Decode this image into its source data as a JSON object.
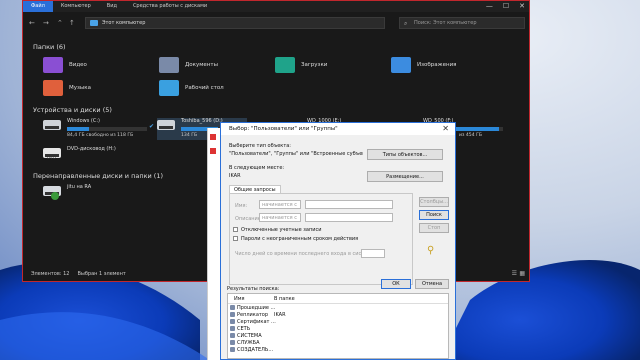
{
  "explorer": {
    "menu": [
      "Файл",
      "Компьютер",
      "Вид",
      "Средства работы с дисками"
    ],
    "active_menu_index": 0,
    "address": "Этот компьютер",
    "search_placeholder": "Поиск: Этот компьютер",
    "nav": {
      "back": "←",
      "forward": "→",
      "up": "⌃",
      "up2": "↑"
    },
    "folders_header": "Папки (6)",
    "folders": [
      {
        "label": "Видео",
        "icon": "video-folder-icon",
        "color": "#8a4fd3"
      },
      {
        "label": "Документы",
        "icon": "documents-folder-icon",
        "color": "#7a8aa8"
      },
      {
        "label": "Загрузки",
        "icon": "downloads-folder-icon",
        "color": "#1fa38a"
      },
      {
        "label": "Изображения",
        "icon": "pictures-folder-icon",
        "color": "#3c8ce0"
      },
      {
        "label": "Музыка",
        "icon": "music-folder-icon",
        "color": "#e0603c"
      },
      {
        "label": "Рабочий стол",
        "icon": "desktop-folder-icon",
        "color": "#3aa0e0"
      }
    ],
    "drives_header": "Устройства и диски (5)",
    "drives": [
      {
        "name": "Windows (C:)",
        "free": "84,4 ГБ свободно из 118 ГБ",
        "used": 0.28
      },
      {
        "name": "Toshiba_596 (D:)",
        "free": "134 ГБ",
        "used": 0.6
      },
      {
        "name": "WD_1000 (E:)",
        "free": "",
        "used": 0.9
      },
      {
        "name": "WD_500 (F:)",
        "free": "из 454 ГБ",
        "used": 0.95
      }
    ],
    "dvd": {
      "name": "DVD-дисковод (H:)",
      "sub": "DVD"
    },
    "network_header": "Перенаправленные диски и папки (1)",
    "network": [
      {
        "name": "jitu на RA"
      }
    ],
    "status": {
      "items": "Элементов: 12",
      "selected": "Выбран 1 элемент"
    },
    "window_controls": {
      "min": "—",
      "max": "☐",
      "close": "✕"
    }
  },
  "dialog": {
    "title": "Выбор: \"Пользователи\" или \"Группы\"",
    "close": "✕",
    "object_type_label": "Выберите тип объекта:",
    "object_type_value": "\"Пользователи\", \"Группы\" или \"Встроенные субъекты безопасности\"",
    "object_types_button": "Типы объектов...",
    "location_label": "В следующем месте:",
    "location_value": "IKAR",
    "location_button": "Размещение...",
    "tab_label": "Общие запросы",
    "name_label": "Имя:",
    "name_op": "начинается с",
    "desc_label": "Описание:",
    "desc_op": "начинается с",
    "check_disabled": "Отключенные учетные записи",
    "check_noexpire": "Пароли с неограниченным сроком действия",
    "days_label": "Число дней со времени последнего входа в систему:",
    "columns_button": "Столбцы...",
    "find_button": "Поиск",
    "stop_button": "Стоп",
    "ok_button": "ОК",
    "cancel_button": "Отмена",
    "results_label": "Результаты поиска:",
    "results_columns": [
      "Имя",
      "В папке"
    ],
    "results": [
      {
        "name": "Прошедшие ...",
        "folder": ""
      },
      {
        "name": "Репликатор",
        "folder": "IKAR"
      },
      {
        "name": "Сертификат ...",
        "folder": ""
      },
      {
        "name": "СЕТЬ",
        "folder": ""
      },
      {
        "name": "СИСТЕМА",
        "folder": ""
      },
      {
        "name": "СЛУЖБА",
        "folder": ""
      },
      {
        "name": "СОЗДАТЕЛЬ...",
        "folder": ""
      }
    ]
  }
}
